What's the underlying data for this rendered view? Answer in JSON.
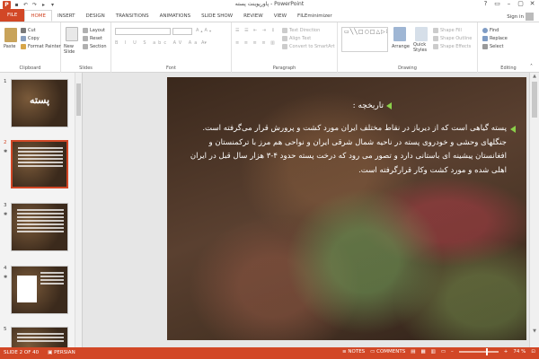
{
  "window": {
    "title": "پاورپوینت پسته - PowerPoint",
    "app_logo": "P",
    "controls": [
      "?",
      "▭",
      "–",
      "▢",
      "✕"
    ]
  },
  "tabs": [
    "FILE",
    "HOME",
    "INSERT",
    "DESIGN",
    "TRANSITIONS",
    "ANIMATIONS",
    "SLIDE SHOW",
    "REVIEW",
    "VIEW",
    "FILEminimizer"
  ],
  "signin": "Sign in",
  "ribbon": {
    "clipboard": {
      "label": "Clipboard",
      "paste": "Paste",
      "cut": "Cut",
      "copy": "Copy",
      "format_painter": "Format Painter"
    },
    "slides": {
      "label": "Slides",
      "new_slide": "New Slide",
      "layout": "Layout",
      "reset": "Reset",
      "section": "Section"
    },
    "font": {
      "label": "Font"
    },
    "paragraph": {
      "label": "Paragraph",
      "text_direction": "Text Direction",
      "align_text": "Align Text",
      "smartart": "Convert to SmartArt"
    },
    "drawing": {
      "label": "Drawing",
      "arrange": "Arrange",
      "quick_styles": "Quick Styles",
      "shape_fill": "Shape Fill",
      "shape_outline": "Shape Outline",
      "shape_effects": "Shape Effects"
    },
    "editing": {
      "label": "Editing",
      "find": "Find",
      "replace": "Replace",
      "select": "Select"
    }
  },
  "thumbnails": [
    {
      "number": "1",
      "title": "پسته",
      "selected": false
    },
    {
      "number": "2",
      "selected": true
    },
    {
      "number": "3",
      "selected": false
    },
    {
      "number": "4",
      "selected": false
    },
    {
      "number": "5",
      "selected": false
    }
  ],
  "slide": {
    "heading": "تاریخچه :",
    "body": "پسته گیاهی است که از دیرباز در نقاط مختلف ایران مورد کشت و پرورش قرار می‌گرفته است. جنگلهای وحشی و خودروی پسته در ناحیه شمال شرقی ایران و نواحی هم مرز با ترکمنستان و افغانستان پیشینه ای باستانی دارد و تصور می رود که درخت پسته حدود ۴-۳ هزار سال قبل در ایران اهلی شده و مورد کشت وکار قرارگرفته است.",
    "bullet_color": "#8bd04a"
  },
  "status": {
    "slide_info": "SLIDE 2 OF 40",
    "language": "PERSIAN",
    "notes": "NOTES",
    "comments": "COMMENTS",
    "zoom": "74 %"
  },
  "colors": {
    "accent": "#d24726"
  }
}
